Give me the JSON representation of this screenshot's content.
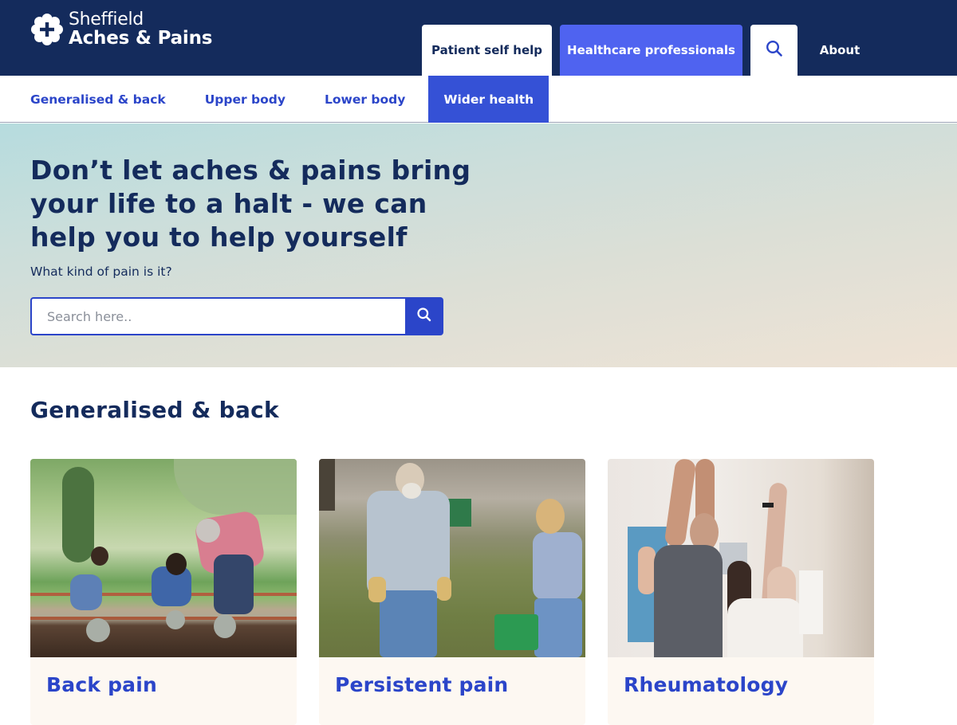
{
  "header": {
    "logo": {
      "line1": "Sheffield",
      "line2": "Aches & Pains",
      "icon": "flower-cross-icon"
    },
    "topnav": [
      {
        "label": "Patient self help",
        "state": "selected"
      },
      {
        "label": "Healthcare professionals",
        "state": "accent"
      },
      {
        "label": "",
        "icon": "search-icon"
      },
      {
        "label": "About"
      }
    ]
  },
  "subnav": {
    "items": [
      {
        "label": "Generalised & back"
      },
      {
        "label": "Upper body"
      },
      {
        "label": "Lower body"
      },
      {
        "label": "Wider health",
        "active": true
      }
    ]
  },
  "hero": {
    "title": "Don’t let aches & pains bring your life to a halt - we can help you to help yourself",
    "subtitle": "What kind of pain is it?",
    "search": {
      "placeholder": "Search here..",
      "value": "",
      "button_icon": "search-icon"
    }
  },
  "section": {
    "title": "Generalised & back",
    "cards": [
      {
        "title": "Back pain",
        "image": "Family gardening in a park"
      },
      {
        "title": "Persistent pain",
        "image": "Older couple walking in a field with a garden cart"
      },
      {
        "title": "Rheumatology",
        "image": "Man and woman stretching arms overhead indoors"
      }
    ]
  },
  "colors": {
    "navy": "#142b5c",
    "accent_blue": "#4f63f0",
    "link_blue": "#2b45c9",
    "card_bg": "#fdf8f2"
  }
}
